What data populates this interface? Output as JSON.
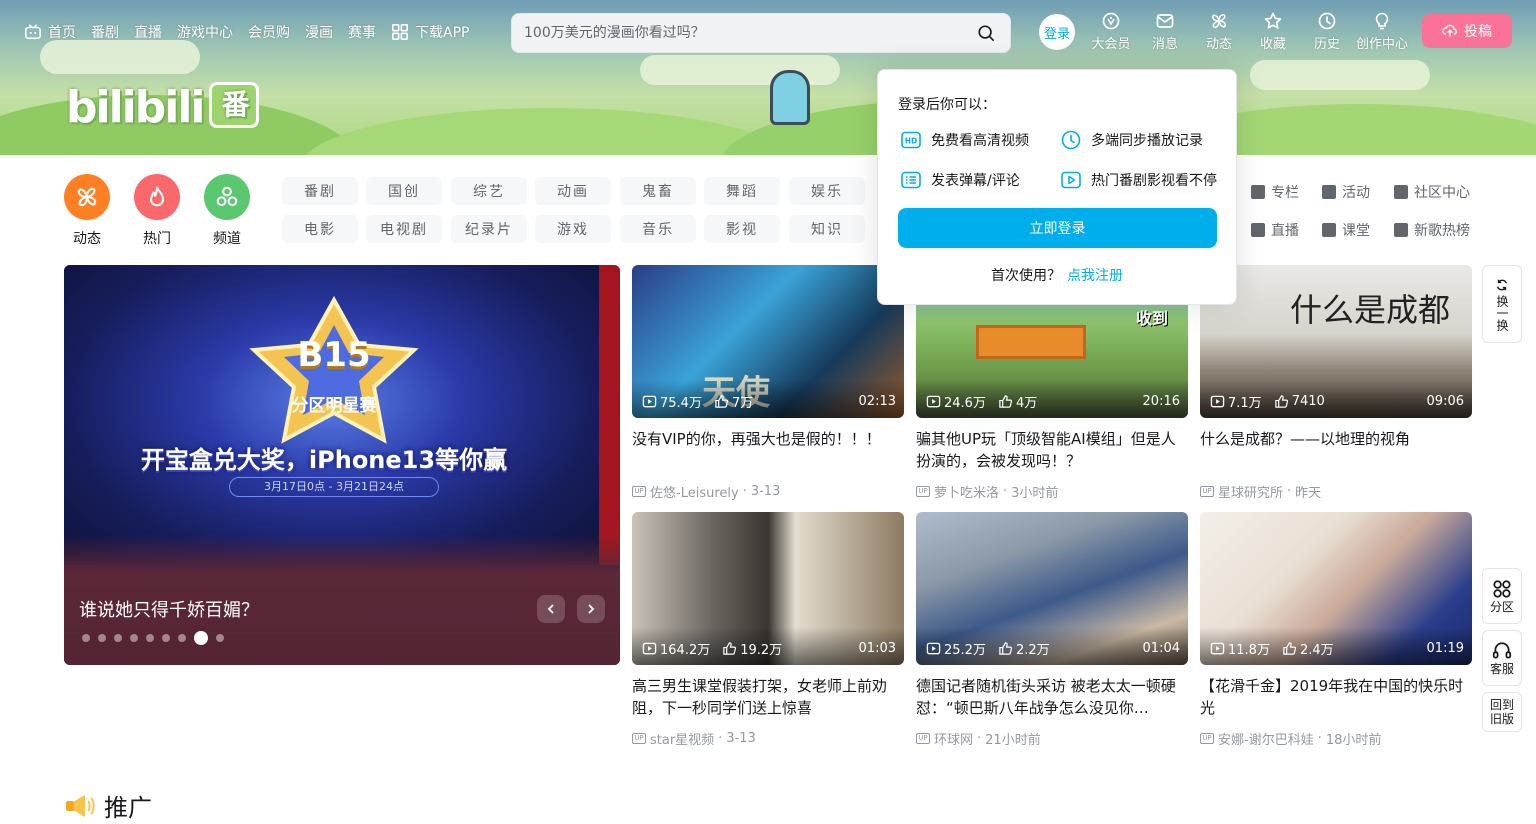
{
  "header": {
    "nav": [
      {
        "label": "首页",
        "icon": "tv-icon"
      },
      {
        "label": "番剧"
      },
      {
        "label": "直播"
      },
      {
        "label": "游戏中心"
      },
      {
        "label": "会员购"
      },
      {
        "label": "漫画"
      },
      {
        "label": "赛事"
      },
      {
        "label": "下载APP",
        "icon": "app-grid-icon"
      }
    ],
    "search_placeholder": "100万美元的漫画你看过吗？",
    "login_label": "登录",
    "right_nav": [
      {
        "label": "大会员",
        "icon": "vip-icon"
      },
      {
        "label": "消息",
        "icon": "mail-icon"
      },
      {
        "label": "动态",
        "icon": "windmill-icon"
      },
      {
        "label": "收藏",
        "icon": "star-icon"
      },
      {
        "label": "历史",
        "icon": "clock-icon"
      },
      {
        "label": "创作中心",
        "icon": "bulb-icon"
      }
    ],
    "upload_label": "投稿",
    "logo_text": "bilibili",
    "logo_badge": "番"
  },
  "channels": {
    "big": [
      {
        "label": "动态",
        "color": "#ff7f24"
      },
      {
        "label": "热门",
        "color": "#f9686b"
      },
      {
        "label": "频道",
        "color": "#5ac86f"
      }
    ],
    "row1": [
      "番剧",
      "国创",
      "综艺",
      "动画",
      "鬼畜",
      "舞蹈",
      "娱乐"
    ],
    "row2": [
      "电影",
      "电视剧",
      "纪录片",
      "游戏",
      "音乐",
      "影视",
      "知识"
    ],
    "right_row1": [
      "专栏",
      "活动",
      "社区中心"
    ],
    "right_row2": [
      "直播",
      "课堂",
      "新歌热榜"
    ]
  },
  "carousel": {
    "title": "谁说她只得千娇百媚？",
    "promo_line": "开宝盒兑大奖，iPhone13等你赢",
    "promo_badge": "B15",
    "promo_sub": "分区明星赛",
    "promo_date": "3月17日0点 - 3月21日24点",
    "dots": 9,
    "active_dot": 7
  },
  "videos": [
    {
      "title": "没有VIP的你，再强大也是假的！！！",
      "views": "75.4万",
      "likes": "7万",
      "duration": "02:13",
      "author": "佐悠-Leisurely",
      "date": "3-13"
    },
    {
      "title": "骗其他UP玩「顶级智能AI模组」但是人扮演的，会被发现吗！？",
      "views": "24.6万",
      "likes": "4万",
      "duration": "20:16",
      "author": "萝卜吃米洛",
      "date": "3小时前"
    },
    {
      "title": "什么是成都？——以地理的视角",
      "views": "7.1万",
      "likes": "7410",
      "duration": "09:06",
      "author": "星球研究所",
      "date": "昨天"
    },
    {
      "title": "高三男生课堂假装打架，女老师上前劝阻，下一秒同学们送上惊喜",
      "views": "164.2万",
      "likes": "19.2万",
      "duration": "01:03",
      "author": "star星视频",
      "date": "3-13"
    },
    {
      "title": "德国记者随机街头采访 被老太太一顿硬怼：“顿巴斯八年战争怎么没见你…",
      "views": "25.2万",
      "likes": "2.2万",
      "duration": "01:04",
      "author": "环球网",
      "date": "21小时前"
    },
    {
      "title": "【花滑千金】2019年我在中国的快乐时光",
      "views": "11.8万",
      "likes": "2.4万",
      "duration": "01:19",
      "author": "安娜-谢尔巴科娃",
      "date": "18小时前"
    }
  ],
  "video_overlays": {
    "thumb1_text": "天使",
    "thumb2_text": "收到",
    "thumb3_text": "什么是成都"
  },
  "up_tag": "UP",
  "float": {
    "refresh": "换一换",
    "category": "分区",
    "service": "客服",
    "old_version": "回到旧版"
  },
  "section": {
    "title": "推广"
  },
  "login_popover": {
    "title": "登录后你可以：",
    "features": [
      {
        "label": "免费看高清视频",
        "icon": "hd-icon"
      },
      {
        "label": "多端同步播放记录",
        "icon": "clock-icon"
      },
      {
        "label": "发表弹幕/评论",
        "icon": "danmaku-icon"
      },
      {
        "label": "热门番剧影视看不停",
        "icon": "play-icon"
      }
    ],
    "login_button": "立即登录",
    "first_time": "首次使用？",
    "register": "点我注册"
  },
  "colors": {
    "accent": "#00aeec",
    "upload": "#fb7299",
    "text_secondary": "#9499a0"
  }
}
